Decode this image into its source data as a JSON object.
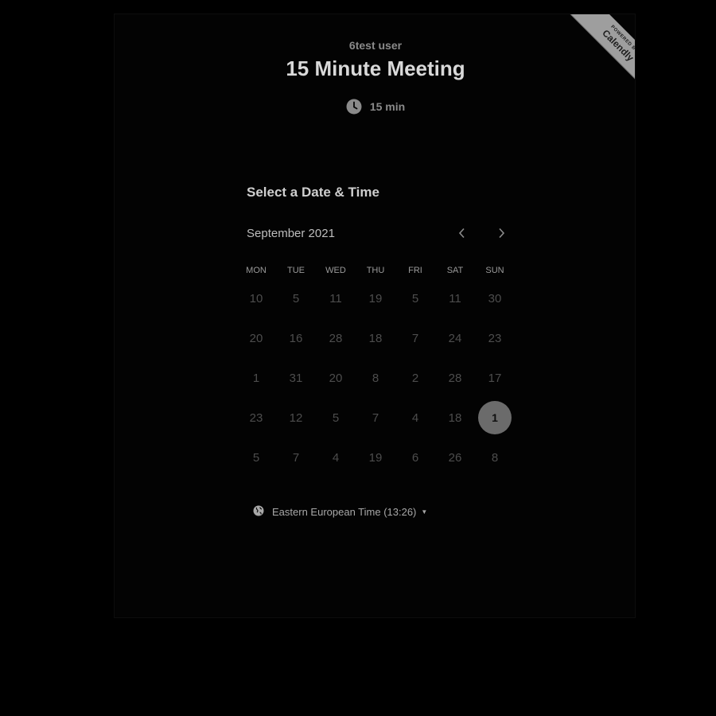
{
  "badge": {
    "line1": "POWERED BY",
    "line2": "Calendly"
  },
  "event": {
    "organizer": "6test user",
    "title": "15 Minute Meeting",
    "duration": "15 min"
  },
  "calendar": {
    "heading": "Select a Date & Time",
    "month": "September 2021",
    "weekdays": [
      "MON",
      "TUE",
      "WED",
      "THU",
      "FRI",
      "SAT",
      "SUN"
    ],
    "days": [
      "10",
      "5",
      "11",
      "19",
      "5",
      "11",
      "30",
      "20",
      "16",
      "28",
      "18",
      "7",
      "24",
      "23",
      "1",
      "31",
      "20",
      "8",
      "2",
      "28",
      "17",
      "23",
      "12",
      "5",
      "7",
      "4",
      "18",
      "1",
      "5",
      "7",
      "4",
      "19",
      "6",
      "26",
      "8"
    ],
    "selected_index": 27
  },
  "timezone": {
    "label": "Eastern European Time (13:26)"
  },
  "colors": {
    "background": "#000000",
    "badge": "#9e9e9e",
    "selected_day": "#6b6b6b"
  }
}
